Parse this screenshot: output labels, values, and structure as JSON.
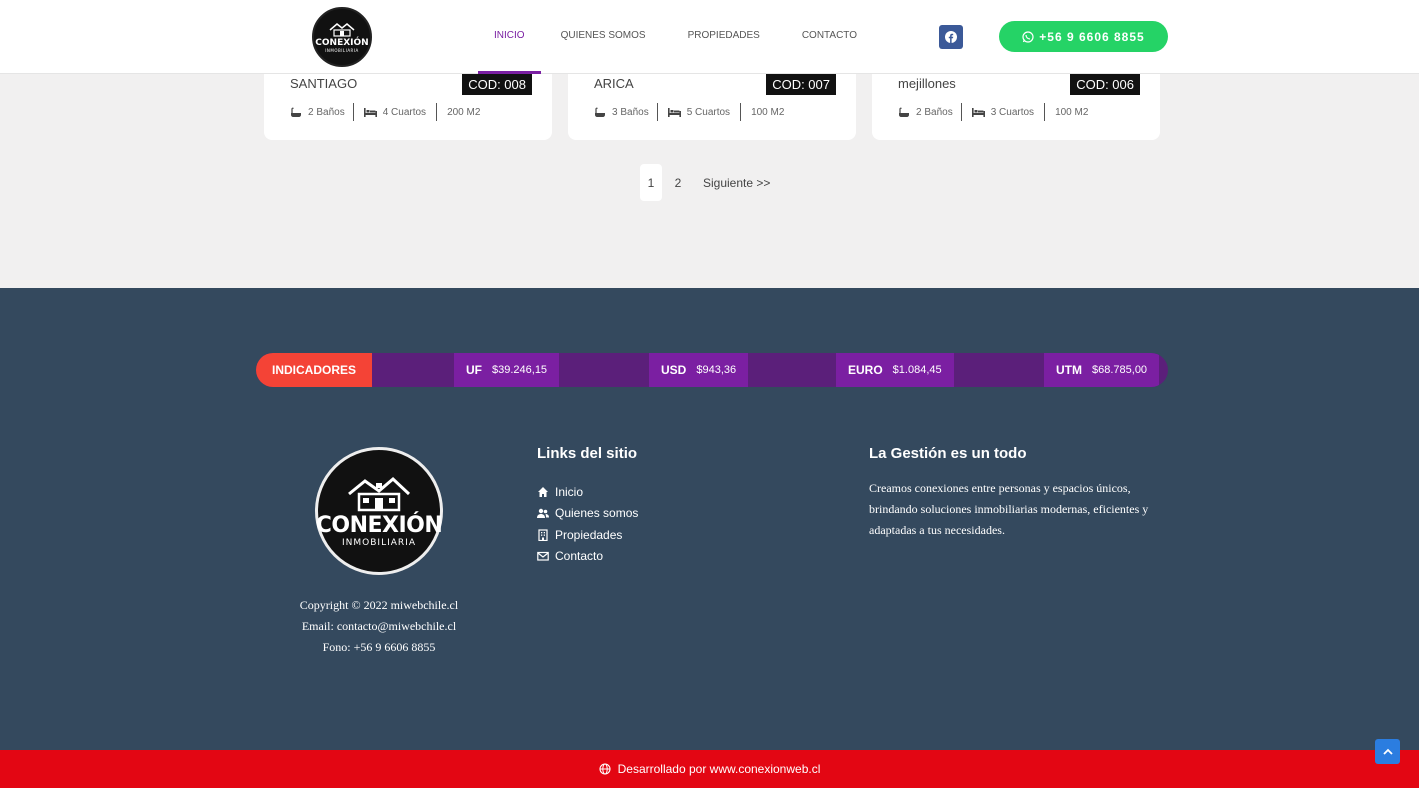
{
  "header": {
    "logo": {
      "brand": "CONEXIÓN",
      "sub": "INMOBILIARIA"
    },
    "nav": [
      {
        "label": "INICIO",
        "active": true
      },
      {
        "label": "QUIENES SOMOS",
        "active": false
      },
      {
        "label": "PROPIEDADES",
        "active": false
      },
      {
        "label": "CONTACTO",
        "active": false
      }
    ],
    "facebook_icon": "facebook-icon",
    "whatsapp_label": "+56 9 6606 8855",
    "accent_color": "#7a1fa2",
    "whatsapp_color": "#25d366"
  },
  "cards": [
    {
      "city": "SANTIAGO",
      "code": "COD: 008",
      "baths": "2 Baños",
      "rooms": "4 Cuartos",
      "area": "200 M2"
    },
    {
      "city": "ARICA",
      "code": "COD: 007",
      "baths": "3 Baños",
      "rooms": "5 Cuartos",
      "area": "100 M2"
    },
    {
      "city": "mejillones",
      "code": "COD: 006",
      "baths": "2 Baños",
      "rooms": "3 Cuartos",
      "area": "100 M2"
    }
  ],
  "pagination": {
    "page1": "1",
    "page2": "2",
    "next": "Siguiente >>"
  },
  "indicators": {
    "label": "INDICADORES",
    "items": [
      {
        "name": "UF",
        "value": "$39.246,15"
      },
      {
        "name": "USD",
        "value": "$943,36"
      },
      {
        "name": "EURO",
        "value": "$1.084,45"
      },
      {
        "name": "UTM",
        "value": "$68.785,00"
      }
    ]
  },
  "footer": {
    "logo": {
      "brand": "CONEXIÓN",
      "sub": "INMOBILIARIA"
    },
    "copyright": "Copyright © 2022 miwebchile.cl",
    "email": "Email: contacto@miwebchile.cl",
    "phone": "Fono: +56 9 6606 8855",
    "links_title": "Links del sitio",
    "links": [
      {
        "label": "Inicio",
        "icon": "home-icon"
      },
      {
        "label": "Quienes somos",
        "icon": "users-icon"
      },
      {
        "label": "Propiedades",
        "icon": "building-icon"
      },
      {
        "label": "Contacto",
        "icon": "envelope-icon"
      }
    ],
    "gestion_title": "La Gestión es un todo",
    "gestion_text": "Creamos conexiones entre personas y espacios únicos, brindando soluciones inmobiliarias modernas, eficientes y adaptadas a tus necesidades.",
    "bg_color": "#34495e"
  },
  "bottom_bar": {
    "text": "Desarrollado por www.conexionweb.cl",
    "color": "#e30613"
  }
}
